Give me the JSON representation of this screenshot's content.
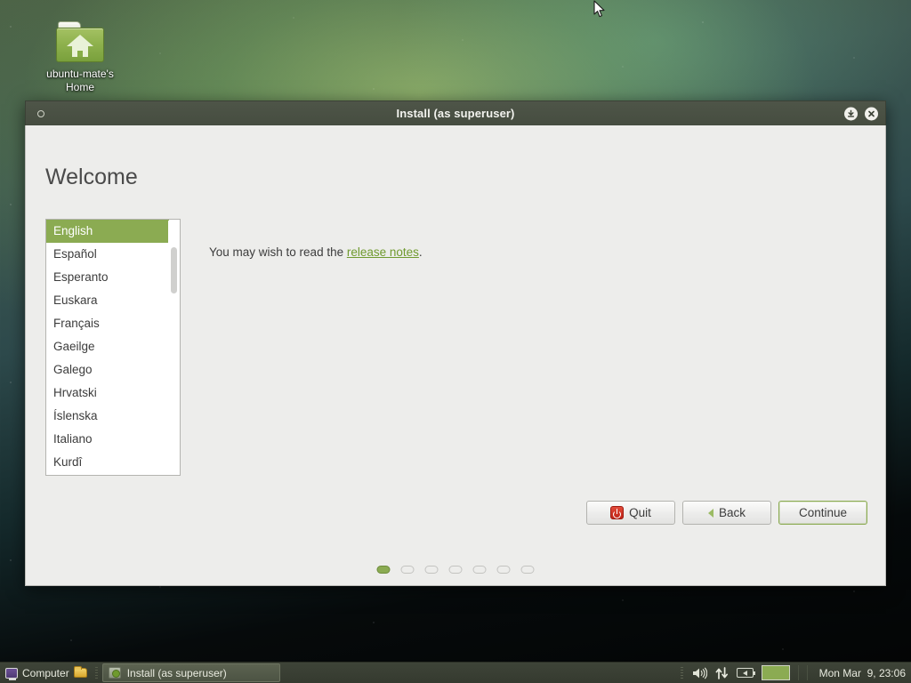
{
  "desktop": {
    "icon": {
      "name": "ubuntu-mate's Home",
      "label_line1": "ubuntu-mate's",
      "label_line2": "Home",
      "glyph": "home-folder-icon"
    },
    "wallpaper_colors": {
      "top_green": "#8fb04e",
      "mid_teal": "#2e4a4c",
      "bottom_black": "#040606"
    }
  },
  "window": {
    "title": "Install (as superuser)",
    "titlebar_color": "#4a5144",
    "shade_button": "window-menu-icon",
    "minimize_button": "minimize-icon",
    "close_button": "close-icon",
    "page_title": "Welcome"
  },
  "languages": {
    "selected": "English",
    "items": [
      "English",
      "Español",
      "Esperanto",
      "Euskara",
      "Français",
      "Gaeilge",
      "Galego",
      "Hrvatski",
      "Íslenska",
      "Italiano",
      "Kurdî"
    ],
    "selected_color": "#8bab52"
  },
  "content": {
    "release_text_before": "You may wish to read the ",
    "release_link": "release notes",
    "release_text_after": ".",
    "link_color": "#6f9a2e"
  },
  "buttons": {
    "quit": "Quit",
    "back": "Back",
    "continue": "Continue",
    "quit_icon": "power-icon",
    "back_icon": "chevron-left-icon"
  },
  "progress": {
    "total_steps": 7,
    "current_step": 1
  },
  "taskbar": {
    "computer_label": "Computer",
    "computer_icon": "computer-icon",
    "folder_icon": "folder-icon",
    "task_button_label": "Install (as superuser)",
    "task_button_icon": "installer-disc-icon",
    "tray": {
      "volume_icon": "volume-icon",
      "network_icon": "network-updown-icon",
      "battery_icon": "battery-icon",
      "workspace_icon": "workspace-switcher"
    },
    "clock": "Mon Mar  9, 23:06"
  }
}
